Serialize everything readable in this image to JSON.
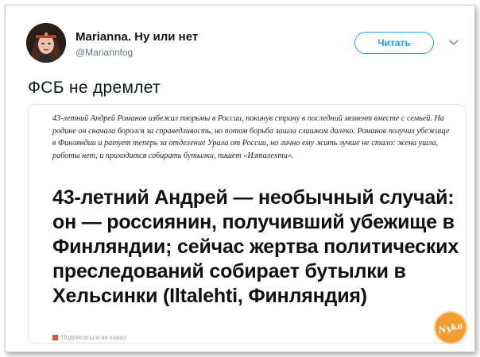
{
  "tweet": {
    "author_name": "Marianna. Ну или нет",
    "author_handle": "@Mariannfog",
    "follow_label": "Читать",
    "text": "ФСБ не дремлет"
  },
  "card": {
    "lead": "43-летний Андрей Романов избежал тюрьмы в России, покинув страну в последний момент вместе с семьей. На родине он сначала боролся за справедливость, но потом борьба зашла слишком далеко. Романов получил убежище в Финляндии и ратует теперь за отделение Урала от России, но лично ему жить лучше не стало: жена ушла, работы нет, и приходится собирать бутылки, пишет «Илталехти».",
    "headline": "43-летний Андрей — необычный случай: он — россиянин, получивший убежище в Финляндии; сейчас жертва политических преследований собирает бутылки в Хельсинки (Iltalehti, Финляндия)",
    "footer_text": "Подписаться на канал"
  },
  "watermark": {
    "text": "Nyka"
  },
  "colors": {
    "accent": "#1da1f2",
    "watermark": "#f39c2f"
  }
}
